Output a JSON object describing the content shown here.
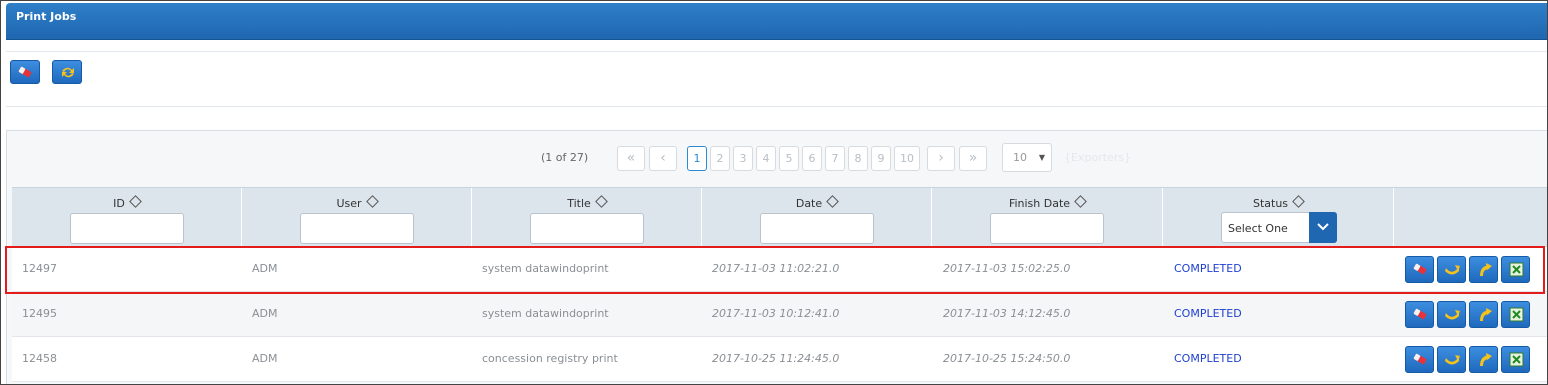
{
  "panel": {
    "title": "Print Jobs"
  },
  "toolbar": {
    "buttons": [
      {
        "icon": "eraser-icon"
      },
      {
        "icon": "refresh-icon"
      }
    ]
  },
  "paginator": {
    "report": "(1 of 27)",
    "first": "«",
    "prev": "‹",
    "pages": [
      "1",
      "2",
      "3",
      "4",
      "5",
      "6",
      "7",
      "8",
      "9",
      "10"
    ],
    "current_page": "1",
    "next": "›",
    "last": "»",
    "rows_per_page": "10",
    "rows_caret": "▼",
    "exporters": "{Exporters}"
  },
  "table": {
    "columns": [
      "ID",
      "User",
      "Title",
      "Date",
      "Finish Date",
      "Status"
    ],
    "status_filter": {
      "selected": "Select One"
    },
    "rows": [
      {
        "id": "12497",
        "user": "ADM",
        "title": "system datawindoprint",
        "date": "2017-11-03 11:02:21.0",
        "finish_date": "2017-11-03 15:02:25.0",
        "status": "COMPLETED"
      },
      {
        "id": "12495",
        "user": "ADM",
        "title": "system datawindoprint",
        "date": "2017-11-03 10:12:41.0",
        "finish_date": "2017-11-03 14:12:45.0",
        "status": "COMPLETED"
      },
      {
        "id": "12458",
        "user": "ADM",
        "title": "concession registry print",
        "date": "2017-10-25 11:24:45.0",
        "finish_date": "2017-10-25 15:24:50.0",
        "status": "COMPLETED"
      }
    ],
    "row_actions": [
      "eraser-icon",
      "undo-icon",
      "redo-icon",
      "spreadsheet-icon"
    ]
  },
  "colors": {
    "header_blue": "#1f67b0",
    "status_blue": "#1e3fd0",
    "highlight_red": "#e41b1b"
  }
}
